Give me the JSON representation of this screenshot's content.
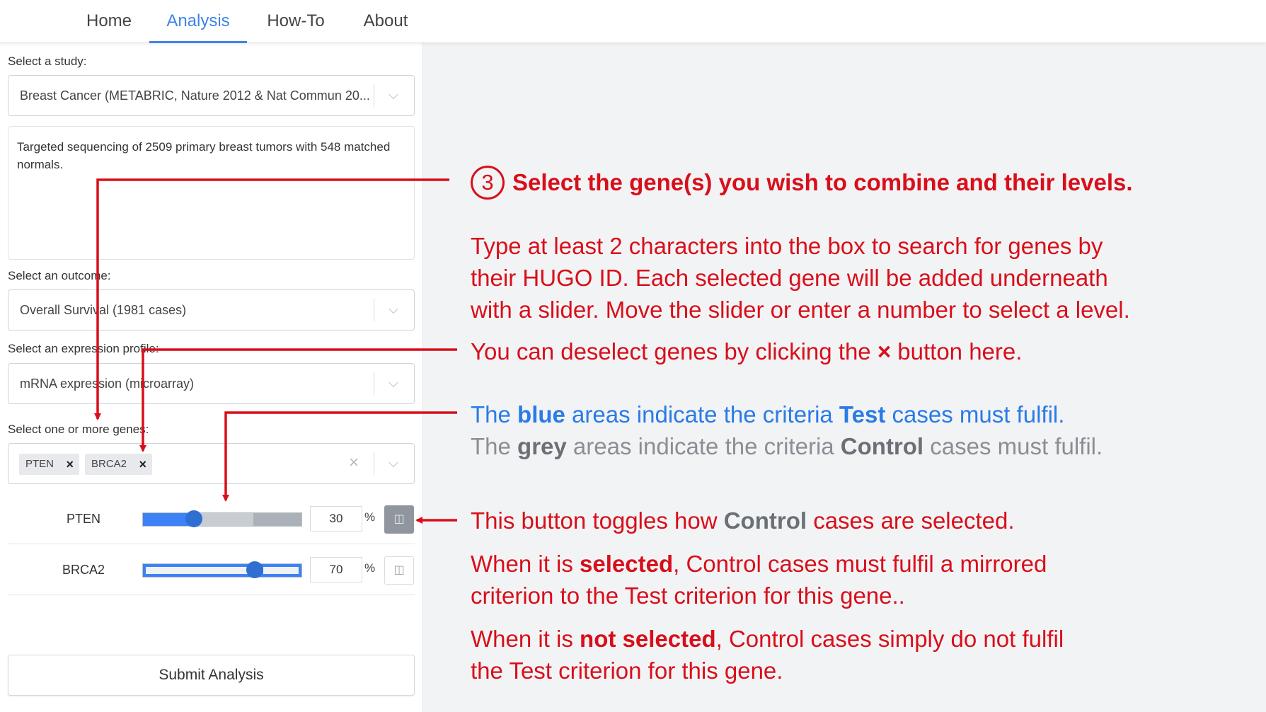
{
  "nav": {
    "tabs": [
      {
        "label": "Home"
      },
      {
        "label": "Analysis"
      },
      {
        "label": "How-To"
      },
      {
        "label": "About"
      }
    ],
    "active": "Analysis"
  },
  "form": {
    "study_label": "Select a study:",
    "study_value": "Breast Cancer (METABRIC, Nature 2012 & Nat Commun 20...",
    "study_description": "Targeted sequencing of 2509 primary breast tumors with 548 matched normals.",
    "outcome_label": "Select an outcome:",
    "outcome_value": "Overall Survival (1981 cases)",
    "profile_label": "Select an expression profile:",
    "profile_value": "mRNA expression (microarray)",
    "genes_label": "Select one or more genes:",
    "selected_genes": [
      "PTEN",
      "BRCA2"
    ],
    "chip_remove_glyph": "×",
    "clear_glyph": "×",
    "chevron_glyph": "⌵",
    "percent_sign": "%",
    "submit_label": "Submit Analysis"
  },
  "gene_rows": [
    {
      "name": "PTEN",
      "value": "30",
      "level": 0.3,
      "toggle_on": true
    },
    {
      "name": "BRCA2",
      "value": "70",
      "level": 0.7,
      "toggle_on": false
    }
  ],
  "annotation": {
    "step_number": "3",
    "title": "Select the gene(s) you wish to combine and their levels.",
    "para1_line1": "Type at least 2 characters into the box to search for genes by",
    "para1_line2": "their HUGO ID. Each selected gene will be added underneath",
    "para1_line3": "with a slider. Move the slider or enter a number to select a level.",
    "deselect_pre": "You can deselect genes by clicking the ",
    "deselect_x": "×",
    "deselect_post": " button here.",
    "blue_pre": "The ",
    "blue_word": "blue",
    "blue_mid": " areas indicate the criteria ",
    "blue_test": "Test",
    "blue_post": " cases must fulfil.",
    "grey_pre": "The ",
    "grey_word": "grey",
    "grey_mid": " areas indicate the criteria ",
    "grey_control": "Control",
    "grey_post": " cases must fulfil.",
    "toggle_pre": "This button toggles how ",
    "toggle_control": "Control",
    "toggle_post": " cases are selected.",
    "sel_pre": "When it is ",
    "sel_word": "selected",
    "sel_post": ", Control cases must fulfil a mirrored",
    "sel_line2": "criterion to the Test criterion for this gene..",
    "notsel_pre": "When it is ",
    "notsel_word": "not selected",
    "notsel_post": ", Control cases simply do not fulfil",
    "notsel_line2": "the Test criterion for this gene."
  },
  "colors": {
    "annotation_red": "#d80f1a",
    "accent_blue": "#3f84e5",
    "control_grey": "#8a8f95"
  }
}
